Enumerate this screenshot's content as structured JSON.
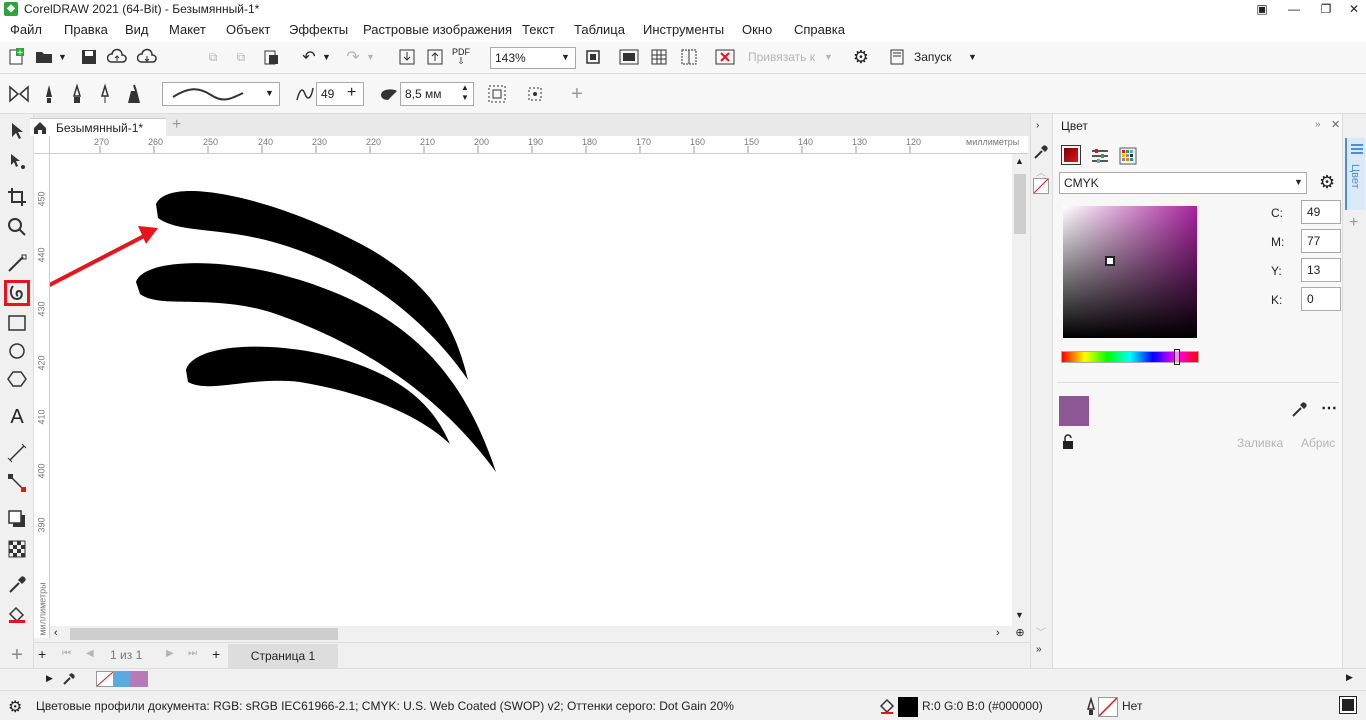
{
  "window": {
    "title": "CorelDRAW 2021 (64-Bit) - Безымянный-1*"
  },
  "menu": [
    {
      "id": "file",
      "label": "Файл"
    },
    {
      "id": "edit",
      "label": "Правка"
    },
    {
      "id": "view",
      "label": "Вид"
    },
    {
      "id": "layout",
      "label": "Макет"
    },
    {
      "id": "object",
      "label": "Объект"
    },
    {
      "id": "effects",
      "label": "Эффекты"
    },
    {
      "id": "bitmaps",
      "label": "Растровые изображения"
    },
    {
      "id": "text",
      "label": "Текст"
    },
    {
      "id": "table",
      "label": "Таблица"
    },
    {
      "id": "tools",
      "label": "Инструменты"
    },
    {
      "id": "window",
      "label": "Окно"
    },
    {
      "id": "help",
      "label": "Справка"
    }
  ],
  "toolbar": {
    "zoom_value": "143%",
    "snap_label": "Привязать к",
    "launch_label": "Запуск",
    "pdf_label": "PDF"
  },
  "property_bar": {
    "smoothing_value": "49",
    "size_value": "8,5 мм"
  },
  "document_tab": {
    "label": "Безымянный-1*"
  },
  "ruler": {
    "top_numbers": [
      "270",
      "260",
      "250",
      "240",
      "230",
      "220",
      "210",
      "200",
      "190",
      "180",
      "170",
      "160",
      "150",
      "140",
      "130",
      "120"
    ],
    "top_unit": "миллиметры",
    "left_numbers": [
      "450",
      "440",
      "430",
      "420",
      "410",
      "400",
      "390"
    ],
    "left_unit": "миллиметры"
  },
  "pagebar": {
    "page_counter": "1",
    "page_of": "из",
    "page_total": "1",
    "page_tab": "Страница 1"
  },
  "color_docker": {
    "title": "Цвет",
    "model": "CMYK",
    "c_label": "C:",
    "c_value": "49",
    "m_label": "M:",
    "m_value": "77",
    "y_label": "Y:",
    "y_value": "13",
    "k_label": "K:",
    "k_value": "0",
    "fill_label": "Заливка",
    "outline_label": "Абрис",
    "swatch_color": "#8d5796",
    "picker_hue": "#a8229e"
  },
  "right_tab": {
    "label": "Цвет"
  },
  "statusbar": {
    "profiles": "Цветовые профили документа: RGB: sRGB IEC61966-2.1; CMYK: U.S. Web Coated (SWOP) v2; Оттенки серого: Dot Gain 20%",
    "fill_info": "R:0 G:0 B:0 (#000000)",
    "outline_info": "Нет"
  },
  "colors": {
    "accent_red": "#e8141b",
    "palette_blue": "#5aa9e0",
    "palette_purple": "#b57bb8"
  }
}
